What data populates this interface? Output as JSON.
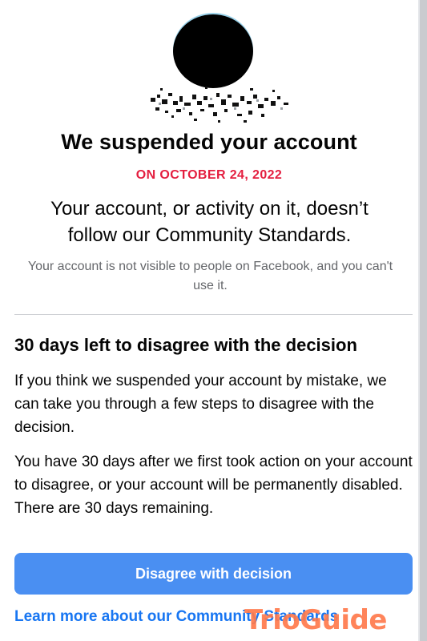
{
  "profile": {
    "avatar_icon": "profile-avatar-redacted",
    "name_label": "Jo..."
  },
  "notice": {
    "title": "We suspended your account",
    "date": "ON OCTOBER 24, 2022",
    "headline": "Your account, or activity on it, doesn’t follow our Community Standards.",
    "subtext": "Your account is not visible to people on Facebook, and you can't use it."
  },
  "appeal": {
    "section_title": "30 days left to disagree with the decision",
    "paragraph_1": "If you think we suspended your account by mistake, we can take you through a few steps to disagree with the decision.",
    "paragraph_2": "You have 30 days after we first took action on your account to disagree, or your account will be permanently disabled. There are 30 days remaining.",
    "primary_button": "Disagree with decision",
    "learn_more_link": "Learn more about our Community Standards"
  },
  "watermark": {
    "text": "TrioGuide"
  },
  "colors": {
    "accent_red": "#e41e3f",
    "button_blue": "#4a8ff2",
    "link_blue": "#1876f2",
    "muted_text": "#65676b",
    "watermark_orange": "#ff7a4d"
  }
}
